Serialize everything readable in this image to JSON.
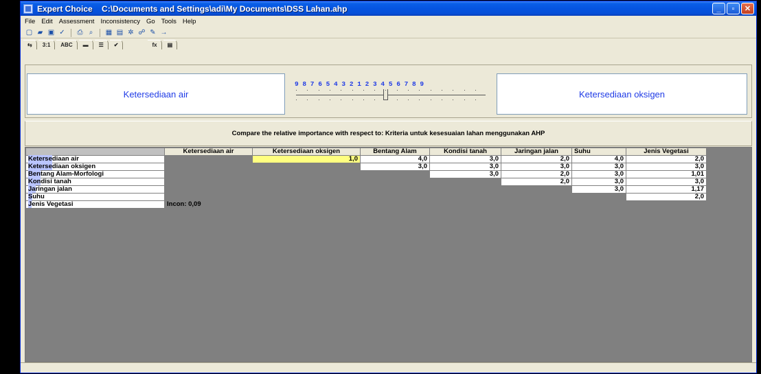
{
  "window": {
    "title": "Expert Choice    C:\\Documents and Settings\\adi\\My Documents\\DSS Lahan.ahp",
    "buttons": {
      "minimize": "_",
      "maximize": "▫",
      "close": "✕"
    }
  },
  "menu": [
    "File",
    "Edit",
    "Assessment",
    "Inconsistency",
    "Go",
    "Tools",
    "Help"
  ],
  "tabs": [
    "⇆",
    "3:1",
    "ABC",
    "▬",
    "☰",
    "✔",
    "fx",
    "▤"
  ],
  "comparison": {
    "left": "Ketersediaan air",
    "right": "Ketersediaan oksigen",
    "scale": "9 8 7 6 5 4 3 2 1 2 3 4 5 6 7 8 9",
    "scale_position": 0.5,
    "prompt": "Compare the relative importance with respect to: Kriteria untuk kesesuaian lahan menggunakan AHP"
  },
  "matrix": {
    "columns": [
      "Ketersediaan air",
      "Ketersediaan oksigen",
      "Bentang Alam",
      "Kondisi tanah",
      "Jaringan jalan",
      "Suhu",
      "Jenis Vegetasi"
    ],
    "rows": [
      {
        "hl": "Keterse",
        "rest": "diaan air",
        "cells": [
          "",
          "1,0",
          "4,0",
          "3,0",
          "2,0",
          "4,0",
          "2,0"
        ]
      },
      {
        "hl": "Keterse",
        "rest": "diaan oksigen",
        "cells": [
          "",
          "",
          "3,0",
          "3,0",
          "3,0",
          "3,0",
          "3,0"
        ]
      },
      {
        "hl": "Ben",
        "rest": "tang Alam-Morfologi",
        "cells": [
          "",
          "",
          "",
          "3,0",
          "2,0",
          "3,0",
          "1,01"
        ]
      },
      {
        "hl": "Kon",
        "rest": "disi tanah",
        "cells": [
          "",
          "",
          "",
          "",
          "2,0",
          "3,0",
          "3,0"
        ]
      },
      {
        "hl": "Ja",
        "rest": "ringan jalan",
        "cells": [
          "",
          "",
          "",
          "",
          "",
          "3,0",
          "1,17"
        ]
      },
      {
        "hl": "S",
        "rest": "uhu",
        "cells": [
          "",
          "",
          "",
          "",
          "",
          "",
          "2,0"
        ]
      },
      {
        "hl": "J",
        "rest": "enis Vegetasi",
        "cells": [
          "Incon: 0,09",
          "",
          "",
          "",
          "",
          "",
          ""
        ]
      }
    ]
  }
}
